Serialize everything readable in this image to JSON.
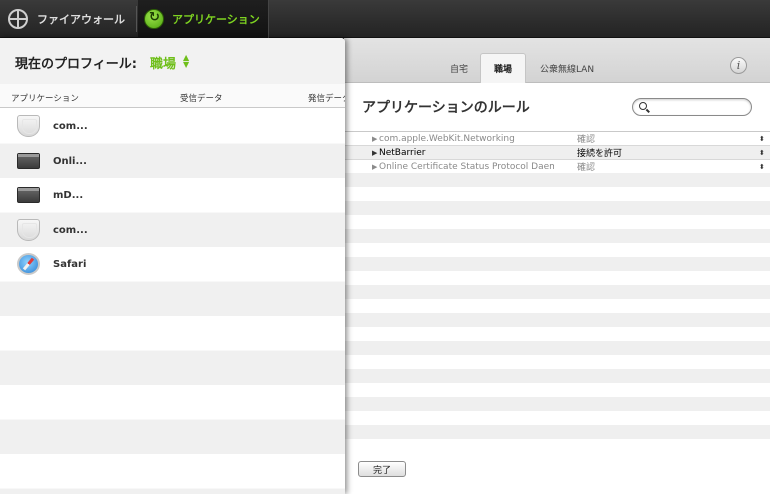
{
  "toolbar": {
    "firewall_label": "ファイアウォール",
    "apps_label": "アプリケーション"
  },
  "profile": {
    "label": "現在のプロフィール:",
    "value": "職場"
  },
  "app_table": {
    "columns": [
      "アプリケーション",
      "受信データ",
      "発信データ"
    ],
    "rows": [
      {
        "name": "com...",
        "icon": "shield-icon"
      },
      {
        "name": "Onli...",
        "icon": "window-icon"
      },
      {
        "name": "mD...",
        "icon": "window-icon"
      },
      {
        "name": "com...",
        "icon": "shield-icon"
      },
      {
        "name": "Safari",
        "icon": "safari-icon"
      }
    ]
  },
  "tabs": {
    "home": "自宅",
    "work": "職場",
    "public_wifi": "公衆無線LAN",
    "selected": "職場"
  },
  "rules": {
    "title": "アプリケーションのルール",
    "search_placeholder": "",
    "rows": [
      {
        "name": "com.apple.WebKit.Networking",
        "action": "確認",
        "active": false
      },
      {
        "name": "NetBarrier",
        "action": "接続を許可",
        "active": true
      },
      {
        "name": "Online Certificate Status Protocol Daemo...",
        "action": "確認",
        "active": false
      }
    ]
  },
  "buttons": {
    "done": "完了",
    "info": "i"
  },
  "colors": {
    "accent_green": "#6fbf1a",
    "toolbar_bg": "#2b2b2b"
  }
}
